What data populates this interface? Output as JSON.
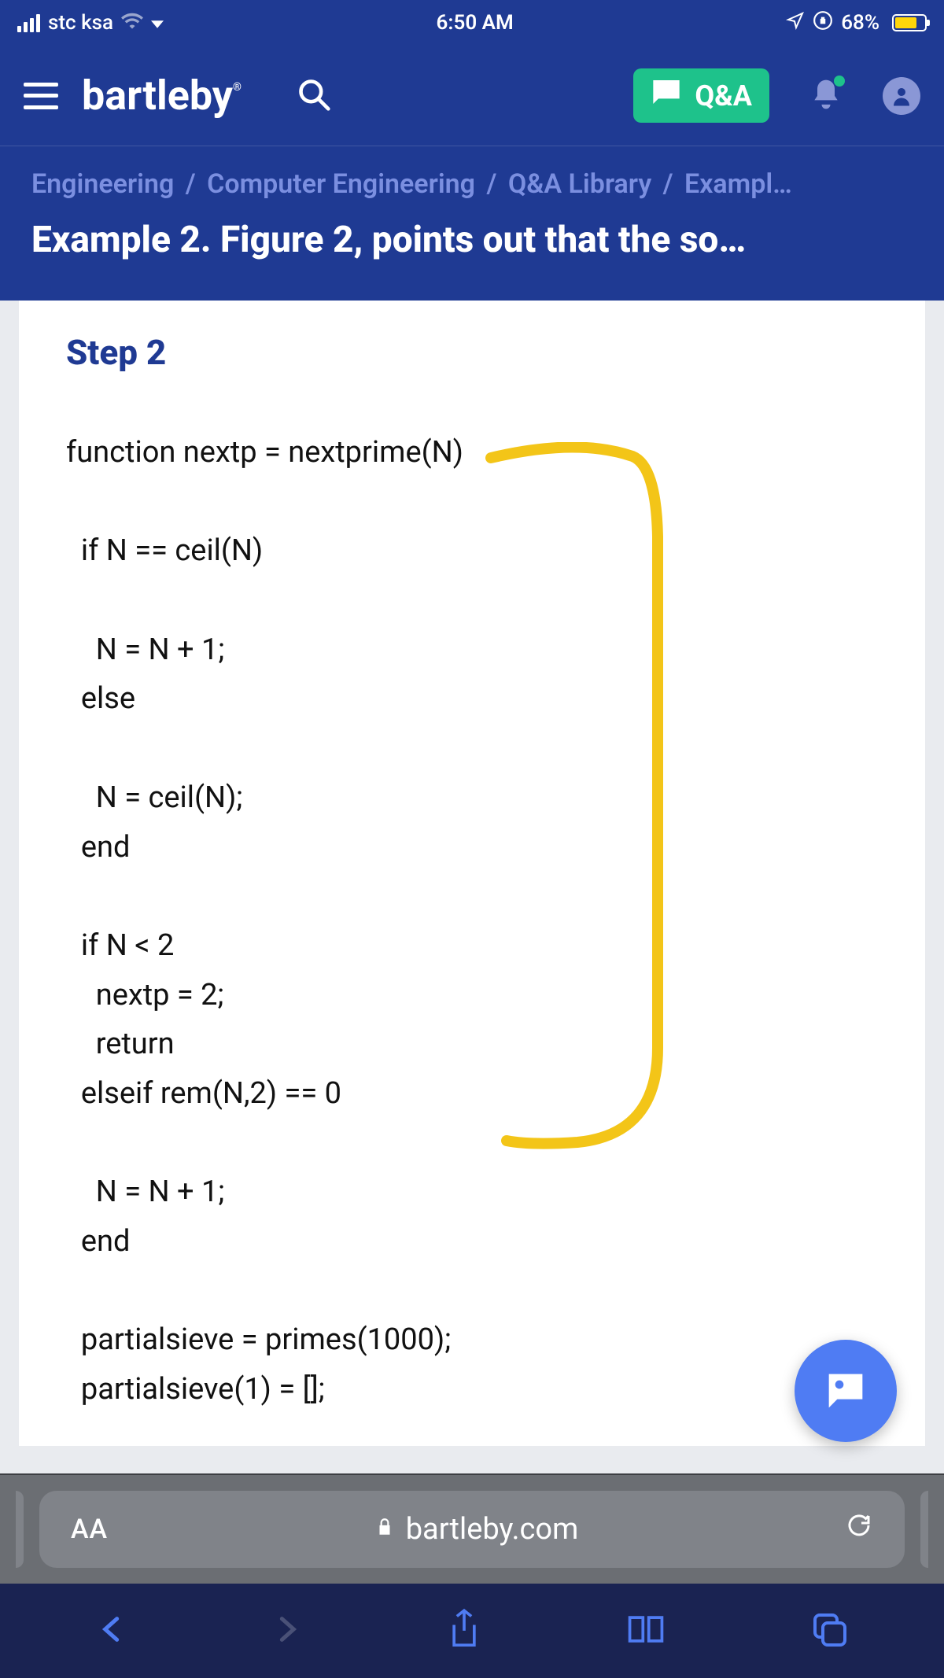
{
  "status": {
    "carrier": "stc ksa",
    "time": "6:50 AM",
    "battery_pct": "68%"
  },
  "header": {
    "brand": "bartleby",
    "qa_label": "Q&A"
  },
  "breadcrumb": {
    "items": [
      "Engineering",
      "Computer Engineering",
      "Q&A Library",
      "Exampl…"
    ],
    "sep": "/"
  },
  "page_title": "Example 2. Figure 2, points out that the so…",
  "content": {
    "step_label": "Step 2",
    "code": "function nextp = nextprime(N)\n\n  if N == ceil(N)\n\n    N = N + 1;\n  else\n\n    N = ceil(N);\n  end\n\n  if N < 2\n    nextp = 2;\n    return\n  elseif rem(N,2) == 0\n\n    N = N + 1;\n  end\n\n  partialsieve = primes(1000);\n  partialsieve(1) = [];"
  },
  "urlbar": {
    "aa": "AA",
    "host": "bartleby.com"
  }
}
